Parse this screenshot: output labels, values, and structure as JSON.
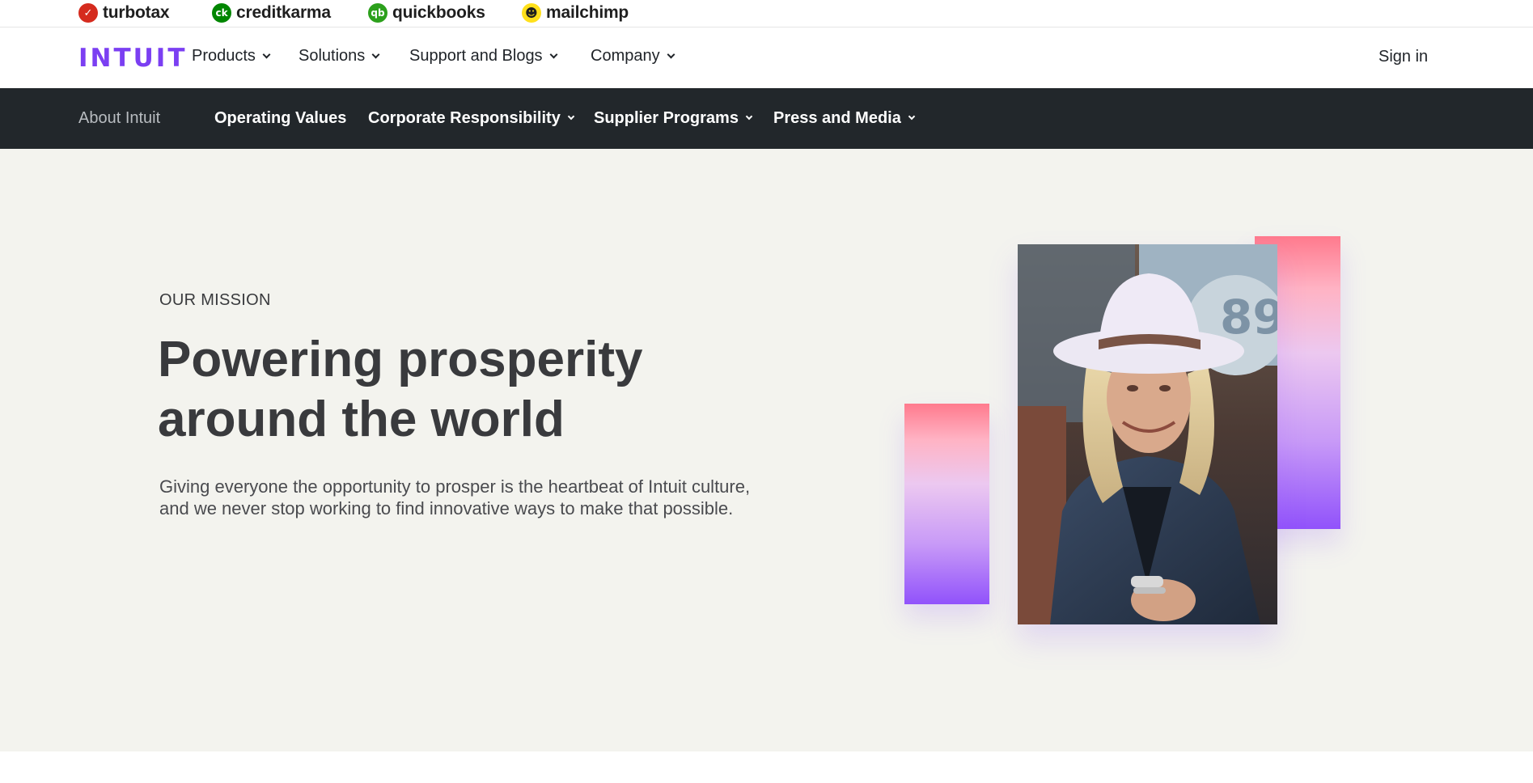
{
  "brands": [
    {
      "name": "turbotax",
      "icon": "check-circle-icon",
      "color": "#d52b1e",
      "glyph": "✓"
    },
    {
      "name": "creditkarma",
      "icon": "ck-circle-icon",
      "color": "#008600",
      "glyph": "ck"
    },
    {
      "name": "quickbooks",
      "icon": "qb-circle-icon",
      "color": "#2ca01c",
      "glyph": "qb"
    },
    {
      "name": "mailchimp",
      "icon": "mailchimp-icon",
      "color": "#ffe01b",
      "glyph": "☻"
    }
  ],
  "main_nav": {
    "logo": "INTUIT",
    "items": [
      "Products",
      "Solutions",
      "Support and Blogs",
      "Company"
    ],
    "sign_in": "Sign in"
  },
  "sub_nav": {
    "about": "About Intuit",
    "items": [
      "Operating Values",
      "Corporate Responsibility",
      "Supplier Programs",
      "Press and Media"
    ]
  },
  "hero": {
    "eyebrow": "OUR MISSION",
    "headline_line1": "Powering prosperity",
    "headline_line2": "around the world",
    "body": "Giving everyone the opportunity to prosper is the heartbeat of Intuit culture, and we never stop working to find innovative ways to make that possible."
  },
  "colors": {
    "accent": "#7b3ff2",
    "subnav_bg": "#22272b",
    "hero_bg": "#f3f3ee"
  }
}
